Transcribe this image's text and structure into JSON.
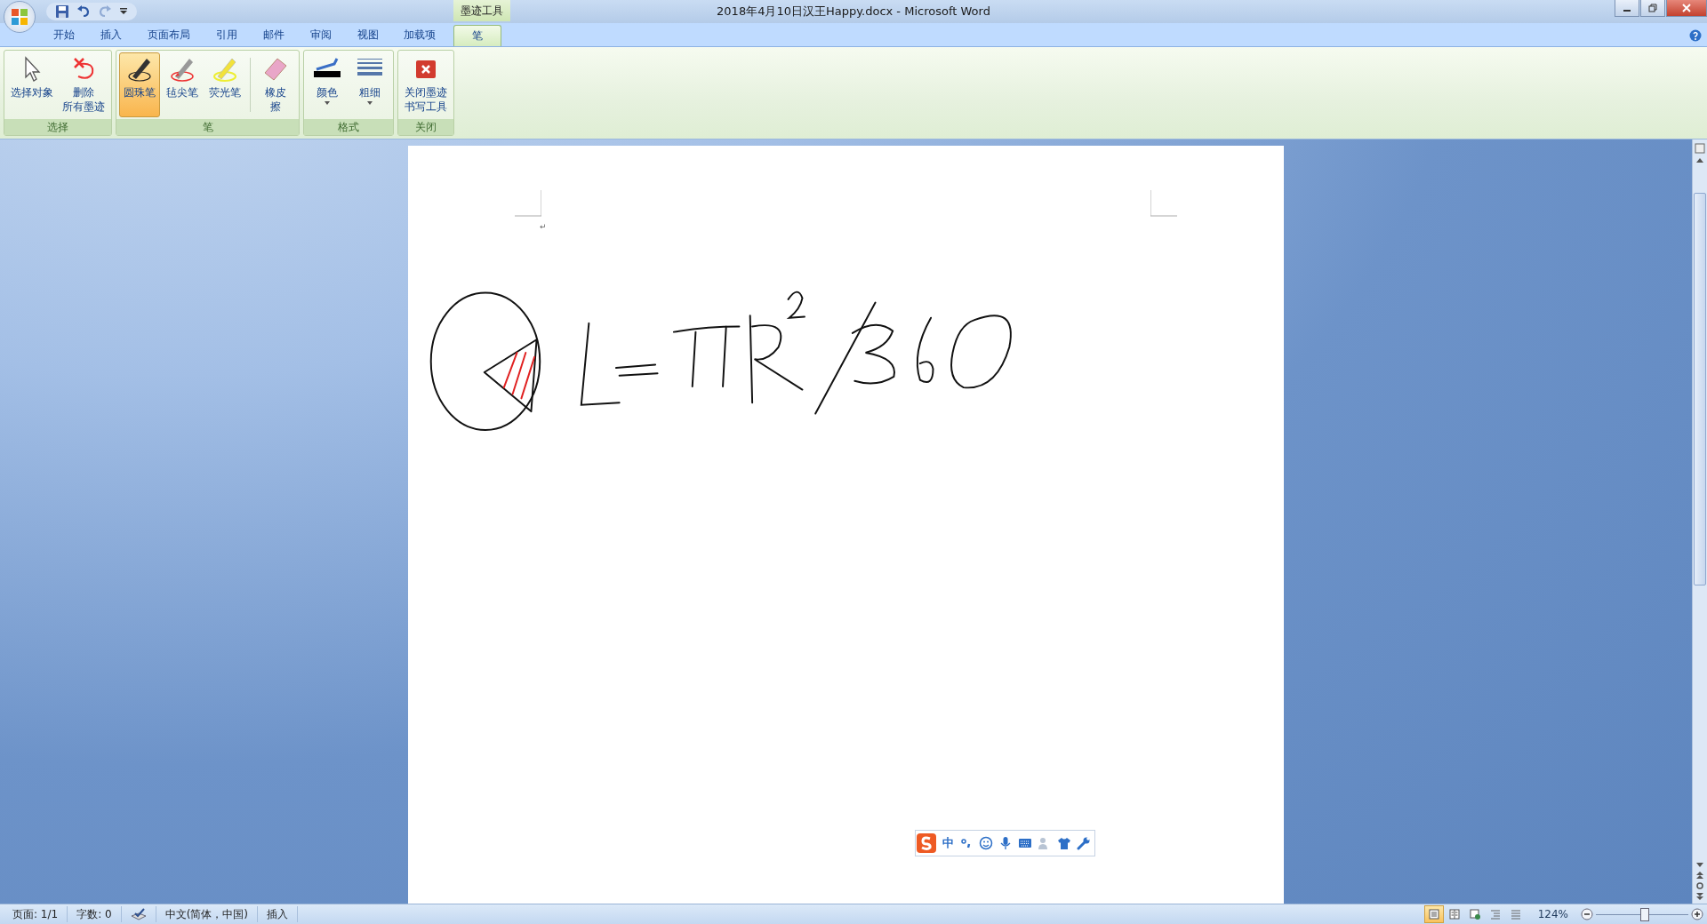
{
  "window": {
    "title": "2018年4月10日汉王Happy.docx - Microsoft Word",
    "contextual_group": "墨迹工具"
  },
  "quick_access": [
    {
      "kind": "save",
      "disabled": false
    },
    {
      "kind": "undo",
      "disabled": false
    },
    {
      "kind": "redo",
      "disabled": true
    },
    {
      "kind": "customize",
      "disabled": false
    }
  ],
  "tabs": [
    {
      "label": "开始",
      "selected": false
    },
    {
      "label": "插入",
      "selected": false
    },
    {
      "label": "页面布局",
      "selected": false
    },
    {
      "label": "引用",
      "selected": false
    },
    {
      "label": "邮件",
      "selected": false
    },
    {
      "label": "审阅",
      "selected": false
    },
    {
      "label": "视图",
      "selected": false
    },
    {
      "label": "加载项",
      "selected": false
    },
    {
      "label": "笔",
      "selected": true
    }
  ],
  "ribbon": {
    "groups": [
      {
        "label": "选择",
        "buttons": [
          {
            "kind": "pointer",
            "lines": [
              "选择对象"
            ],
            "selected": false
          },
          {
            "kind": "delete-ink",
            "lines": [
              "删除",
              "所有墨迹"
            ],
            "selected": false
          }
        ]
      },
      {
        "label": "笔",
        "buttons": [
          {
            "kind": "ballpoint",
            "lines": [
              "圆珠笔"
            ],
            "selected": true
          },
          {
            "kind": "felt-tip",
            "lines": [
              "毡尖笔"
            ],
            "selected": false
          },
          {
            "kind": "highlighter",
            "lines": [
              "荧光笔"
            ],
            "selected": false
          },
          {
            "kind": "eraser",
            "lines": [
              "橡皮",
              "擦"
            ],
            "selected": false
          }
        ]
      },
      {
        "label": "格式",
        "buttons": [
          {
            "kind": "color",
            "lines": [
              "颜色"
            ],
            "selected": false,
            "dropdown": true
          },
          {
            "kind": "thickness",
            "lines": [
              "粗细"
            ],
            "selected": false,
            "dropdown": true
          }
        ]
      },
      {
        "label": "关闭",
        "buttons": [
          {
            "kind": "close-ink",
            "lines": [
              "关闭墨迹",
              "书写工具"
            ],
            "selected": false
          }
        ]
      }
    ]
  },
  "document": {
    "paragraph_mark": "↵"
  },
  "ime_toolbar": {
    "mode": "中"
  },
  "status_bar": {
    "items": [
      {
        "kind": "text",
        "label": "页面: 1/1"
      },
      {
        "kind": "text",
        "label": "字数: 0"
      },
      {
        "kind": "proofing"
      },
      {
        "kind": "text",
        "label": "中文(简体，中国)"
      },
      {
        "kind": "text",
        "label": "插入"
      }
    ],
    "views": [
      {
        "kind": "print-layout",
        "selected": true
      },
      {
        "kind": "reading",
        "selected": false
      },
      {
        "kind": "web",
        "selected": false
      },
      {
        "kind": "outline",
        "selected": false
      },
      {
        "kind": "draft",
        "selected": false
      }
    ],
    "zoom": {
      "label": "124%",
      "level": 0.52
    }
  }
}
